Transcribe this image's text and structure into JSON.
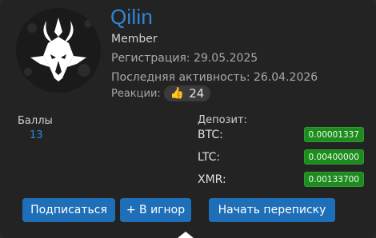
{
  "profile": {
    "username": "Qilin",
    "role": "Member",
    "registration": "Регистрация: 29.05.2025",
    "last_activity": "Последняя активность: 26.04.2026",
    "reactions_label": "Реакции:",
    "reactions_icon": "thumbs-up-icon",
    "reactions_count": "24"
  },
  "stats": {
    "points_label": "Баллы",
    "points_value": "13",
    "deposit_label": "Депозит:",
    "coins": [
      {
        "name": "BTC:",
        "amount": "0.00001337"
      },
      {
        "name": "LTC:",
        "amount": "0.00400000"
      },
      {
        "name": "XMR:",
        "amount": "0.00133700"
      }
    ]
  },
  "actions": {
    "subscribe_label": "Подписаться",
    "ignore_label": "+ В игнор",
    "message_label": "Начать переписку"
  },
  "colors": {
    "accent": "#2f86d6",
    "button": "#1f6fb8",
    "badge": "#1f8a1f",
    "background": "#232323"
  }
}
